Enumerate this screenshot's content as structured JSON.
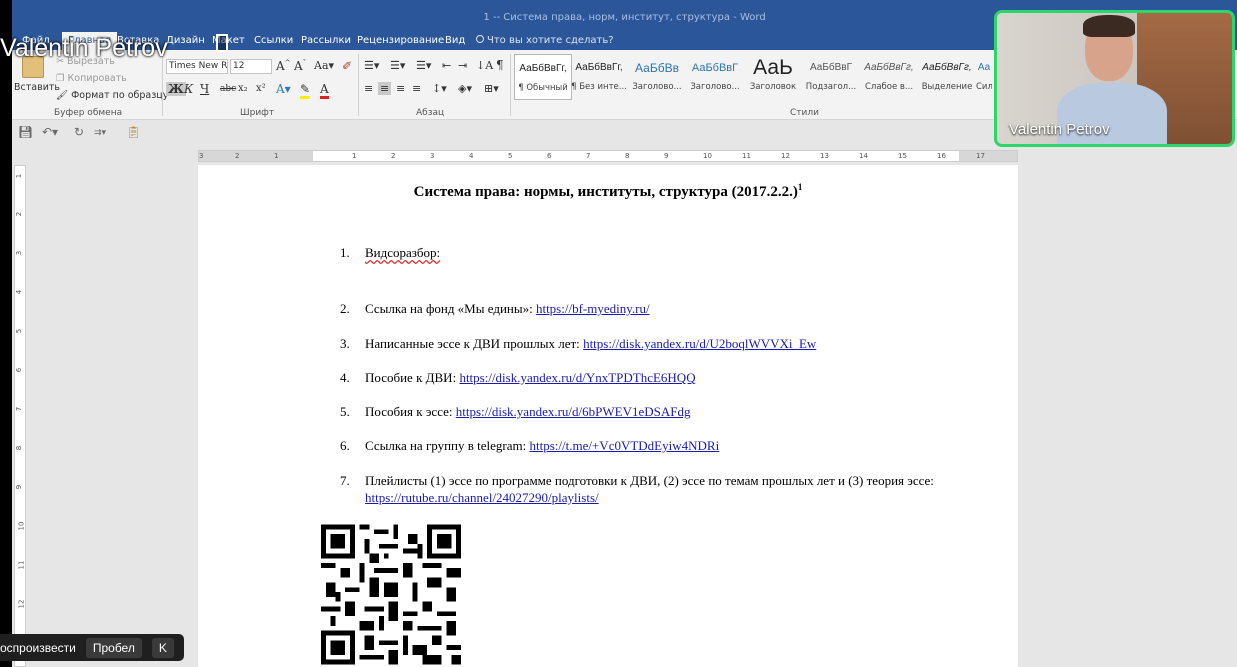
{
  "window": {
    "title": "1 -- Система права, норм, институт, структура - Word"
  },
  "tabs": [
    "Файл",
    "Главная",
    "Вставка",
    "Дизайн",
    "Макет",
    "Ссылки",
    "Рассылки",
    "Рецензирование",
    "Вид"
  ],
  "tell_me": "Что вы хотите сделать?",
  "clipboard": {
    "paste": "Вставить",
    "cut": "Вырезать",
    "copy": "Копировать",
    "format_painter": "Формат по образцу",
    "group": "Буфер обмена"
  },
  "font": {
    "name": "Times New R",
    "size": "12",
    "bold": "Ж",
    "italic": "К",
    "underline": "Ч",
    "strike": "abc",
    "sub": "x₂",
    "sup": "x²",
    "group": "Шрифт"
  },
  "paragraph": {
    "group": "Абзац"
  },
  "styles": {
    "group": "Стили",
    "items": [
      {
        "preview": "АаБбВвГг,",
        "name": "¶ Обычный"
      },
      {
        "preview": "АаБбВвГг,",
        "name": "¶ Без инте..."
      },
      {
        "preview": "АаБбВв",
        "name": "Заголово..."
      },
      {
        "preview": "АаБбВвГ",
        "name": "Заголово..."
      },
      {
        "preview": "АаЬ",
        "name": "Заголовок"
      },
      {
        "preview": "АаБбВвГ",
        "name": "Подзагол..."
      },
      {
        "preview": "АаБбВвГг,",
        "name": "Слабое в..."
      },
      {
        "preview": "АаБбВвГг,",
        "name": "Выделение"
      },
      {
        "preview": "Аа",
        "name": "Сил"
      }
    ]
  },
  "ruler": {
    "h_ticks": [
      "3",
      "2",
      "1",
      "1",
      "2",
      "3",
      "4",
      "5",
      "6",
      "7",
      "8",
      "9",
      "10",
      "11",
      "12",
      "13",
      "14",
      "15",
      "16",
      "17"
    ],
    "v_ticks": [
      "1",
      "2",
      "3",
      "4",
      "5",
      "6",
      "7",
      "8",
      "9",
      "10",
      "11",
      "12"
    ]
  },
  "document": {
    "title": "Система права: нормы, институты, структура (2017.2.2.)",
    "title_sup": "1",
    "items": [
      {
        "num": "1.",
        "text": "Видсоразбор:",
        "link": ""
      },
      {
        "num": "2.",
        "text": "Ссылка на фонд «Мы едины»: ",
        "link": "https://bf-myediny.ru/"
      },
      {
        "num": "3.",
        "text": "Написанные эссе к ДВИ прошлых лет: ",
        "link": "https://disk.yandex.ru/d/U2boqlWVVXi_Ew"
      },
      {
        "num": "4.",
        "text": "Пособие к ДВИ: ",
        "link": "https://disk.yandex.ru/d/YnxTPDThcE6HQQ"
      },
      {
        "num": "5.",
        "text": "Пособия к эссе: ",
        "link": "https://disk.yandex.ru/d/6bPWEV1eDSAFdg"
      },
      {
        "num": "6.",
        "text": "Ссылка на группу в telegram: ",
        "link": "https://t.me/+Vc0VTDdEyiw4NDRi"
      },
      {
        "num": "7.",
        "text": "Плейлисты (1) эссе по программе подготовки к ДВИ, (2) эссе по темам прошлых лет и (3) теория эссе: ",
        "link": "https://rutube.ru/channel/24027290/playlists/"
      }
    ]
  },
  "participant": {
    "name": "Valentin Petrov",
    "overlay_name": "Valentin Petrov"
  },
  "key_hint": {
    "action": "оспроизвести",
    "key1": "Пробел",
    "key2": "K"
  },
  "colors": {
    "accent": "#2b579a",
    "speaker_border": "#2bd66a",
    "link": "#1a1ab8"
  }
}
